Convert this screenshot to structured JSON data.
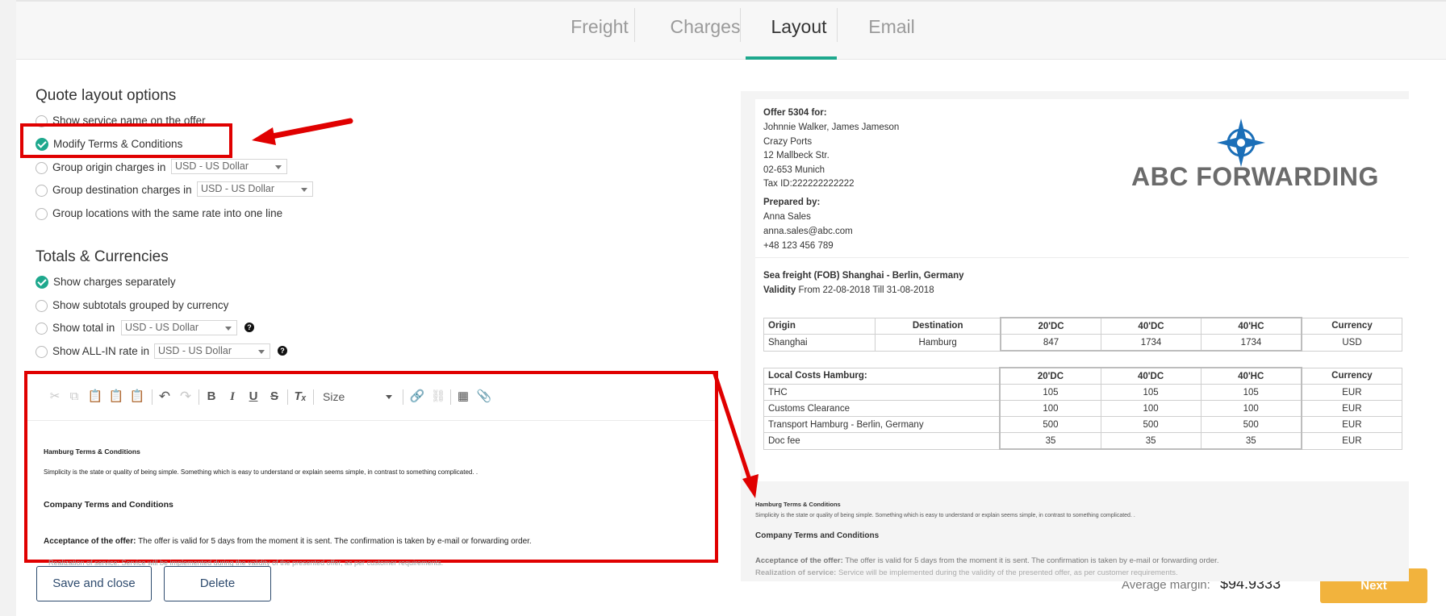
{
  "tabs": [
    {
      "label": "Freight"
    },
    {
      "label": "Charges"
    },
    {
      "label": "Layout"
    },
    {
      "label": "Email"
    }
  ],
  "quote_layout": {
    "title": "Quote layout options",
    "options": [
      {
        "label": "Show service name on the offer",
        "checked": false
      },
      {
        "label": "Modify Terms & Conditions",
        "checked": true
      },
      {
        "label": "Group origin charges in",
        "checked": false,
        "select": "USD - US Dollar"
      },
      {
        "label": "Group destination charges in",
        "checked": false,
        "select": "USD - US Dollar"
      },
      {
        "label": "Group locations with the same rate into one line",
        "checked": false
      }
    ]
  },
  "totals": {
    "title": "Totals & Currencies",
    "options": [
      {
        "label": "Show charges separately",
        "checked": true
      },
      {
        "label": "Show subtotals grouped by currency",
        "checked": false
      },
      {
        "label": "Show total in",
        "checked": false,
        "select": "USD - US Dollar",
        "help": "?"
      },
      {
        "label": "Show ALL-IN rate in",
        "checked": false,
        "select": "USD - US Dollar",
        "help": "?"
      }
    ]
  },
  "editor": {
    "size_label": "Size",
    "heading1": "Hamburg Terms & Conditions",
    "para1": "Simplicity is the state or quality of being simple. Something which is easy to understand or explain seems simple, in contrast to something complicated. .",
    "heading2": "Company Terms and Conditions",
    "accept_label": "Acceptance of the offer:",
    "accept_text": " The offer is valid for 5 days from the moment it is sent. The confirmation is taken by e-mail or forwarding order.",
    "realization_partial": "Realization of service: Service will be implemented during the validity of the presented offer, as per customer requirements."
  },
  "buttons": {
    "save_close": "Save and close",
    "delete": "Delete",
    "next": "Next"
  },
  "margin": {
    "label": "Average margin:",
    "value": "$94.9333"
  },
  "preview": {
    "offer_title": "Offer 5304 for:",
    "client_lines": [
      "Johnnie Walker, James Jameson",
      "Crazy Ports",
      "12 Mallbeck Str.",
      "02-653 Munich",
      "Tax ID:222222222222"
    ],
    "prepared_title": "Prepared by:",
    "prepared_lines": [
      "Anna Sales",
      "anna.sales@abc.com",
      "+48 123 456 789"
    ],
    "logo_text": "ABC FORWARDING",
    "freight_title": "Sea freight (FOB) Shanghai - Berlin, Germany",
    "validity_label": "Validity",
    "validity_text": " From 22-08-2018 Till 31-08-2018",
    "table1": {
      "headers": [
        "Origin",
        "Destination",
        "20'DC",
        "40'DC",
        "40'HC",
        "Currency"
      ],
      "rows": [
        [
          "Shanghai",
          "Hamburg",
          "847",
          "1734",
          "1734",
          "USD"
        ]
      ]
    },
    "table2": {
      "headers": [
        "Local Costs Hamburg:",
        "20'DC",
        "40'DC",
        "40'HC",
        "Currency"
      ],
      "rows": [
        [
          "THC",
          "105",
          "105",
          "105",
          "EUR"
        ],
        [
          "Customs Clearance",
          "100",
          "100",
          "100",
          "EUR"
        ],
        [
          "Transport Hamburg - Berlin, Germany",
          "500",
          "500",
          "500",
          "EUR"
        ],
        [
          "Doc fee",
          "35",
          "35",
          "35",
          "EUR"
        ]
      ]
    },
    "terms_heading1": "Hamburg Terms & Conditions",
    "terms_para1": "Simplicity is the state or quality of being simple. Something which is easy to understand or explain seems simple, in contrast to something complicated. .",
    "terms_heading2": "Company Terms and Conditions",
    "accept_label": "Acceptance of the offer:",
    "accept_text": " The offer is valid for 5 days from the moment it is sent. The confirmation is taken by e-mail or forwarding order.",
    "real_label": "Realization of service:",
    "real_text": " Service will be implemented during the validity of the presented offer, as per customer requirements."
  },
  "colors": {
    "accent": "#1ea88d",
    "next_button": "#f2b33d",
    "annotation": "#e00000",
    "logo_blue": "#1b6fb8"
  }
}
